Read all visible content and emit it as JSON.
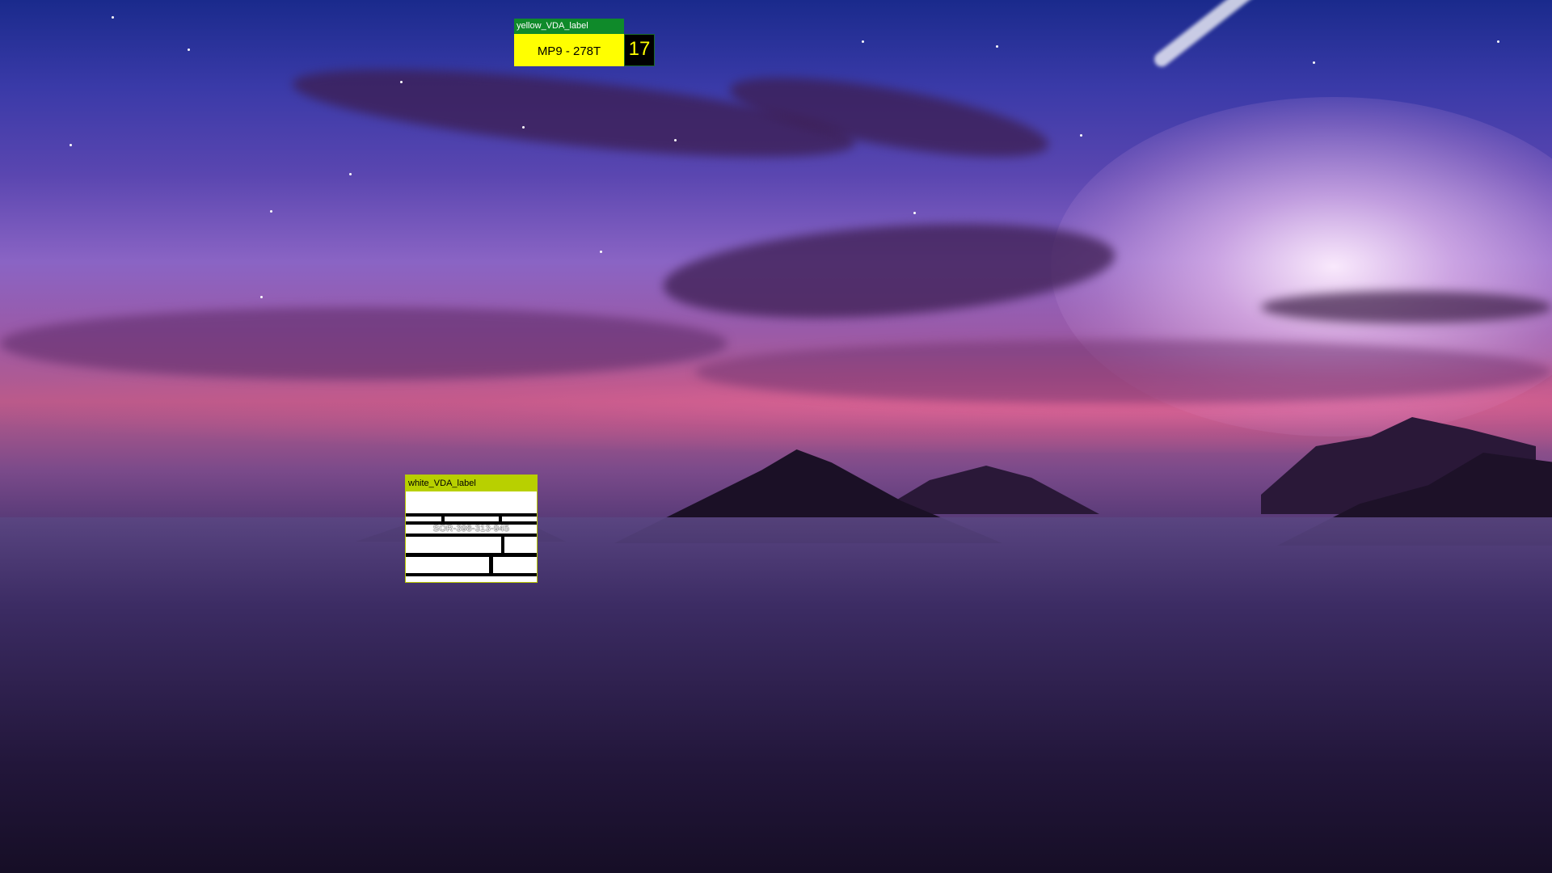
{
  "desktop": {
    "wallpaper": "mountain-sunset-clouds",
    "colors": {
      "sky_top": "#1a2a8c",
      "sky_glow": "#f0e0ff",
      "horizon_pink": "#e06aa0",
      "fog_dark": "#180f2c"
    }
  },
  "yellow_label": {
    "title": "yellow_VDA_label",
    "text": "MP9 - 278T",
    "count": "17",
    "colors": {
      "title_bg": "#0f8a2a",
      "body_bg": "#ffff00",
      "counter_bg": "#000000",
      "counter_text": "#ffff00"
    }
  },
  "white_label": {
    "title": "white_VDA_label",
    "code": "SOR-398-313-945",
    "colors": {
      "title_bg": "#b8d000",
      "body_bg": "#ffffff",
      "bars": "#000000"
    }
  }
}
